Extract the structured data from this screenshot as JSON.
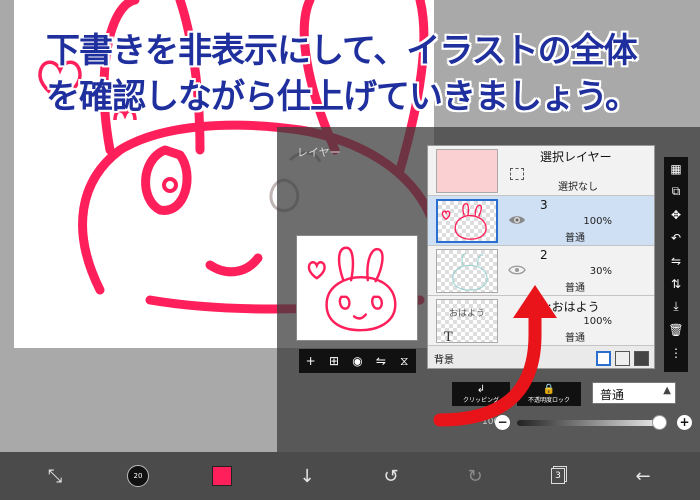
{
  "caption": {
    "line1": "下書きを非表示にして、イラストの全体",
    "line2": "を確認しながら仕上げていきましょう。"
  },
  "layer_panel": {
    "title": "レイヤー",
    "layers": [
      {
        "name": "選択レイヤー",
        "detail": "選択なし"
      },
      {
        "name": "3",
        "opacity": "100%",
        "blend": "普通"
      },
      {
        "name": "2",
        "opacity": "30%",
        "blend": "普通"
      },
      {
        "name": "1:おはよう",
        "opacity": "100%",
        "blend": "普通",
        "thumb_text": "おはよう",
        "thumb_glyph": "T"
      }
    ],
    "background_label": "背景",
    "clipping_label": "クリッピング",
    "alpha_lock_label": "不透明度ロック",
    "blend_mode": "普通",
    "blend_arrow": "▲",
    "opacity_value": "100%",
    "minus": "−",
    "plus": "+"
  },
  "preview_toolbar": [
    "+",
    "⊞",
    "◉",
    "⇋",
    "⧖"
  ],
  "side_toolbar": [
    "▦",
    "⧉",
    "✥",
    "↶",
    "⇋",
    "⇅",
    "⤓",
    "🗑",
    "⋮"
  ],
  "bottom_bar": {
    "transform": "⤡",
    "brush_size": "20",
    "down_arrow": "↓",
    "undo": "↺",
    "redo": "↻",
    "layer_count": "3",
    "back": "←"
  },
  "colors": {
    "caption": "#1f2f9e",
    "accent_pink": "#ff1f5a",
    "arrow_red": "#e8141a",
    "active_layer": "#cfe0f5"
  }
}
